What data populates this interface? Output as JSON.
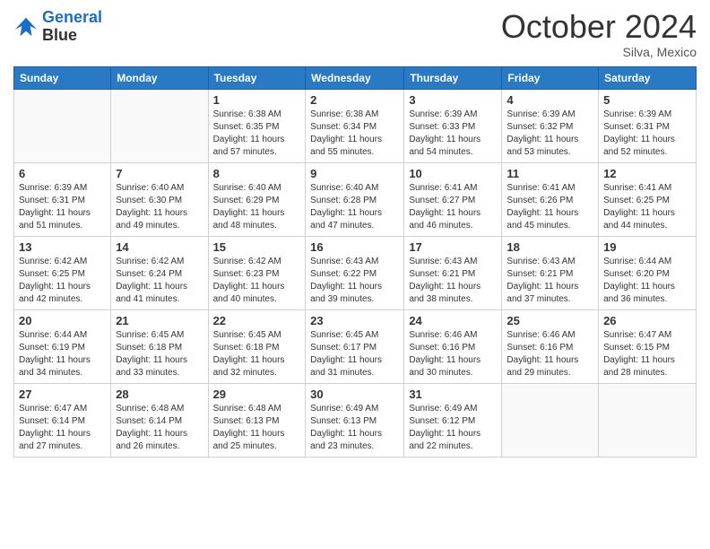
{
  "logo": {
    "line1": "General",
    "line2": "Blue"
  },
  "header": {
    "month": "October 2024",
    "location": "Silva, Mexico"
  },
  "weekdays": [
    "Sunday",
    "Monday",
    "Tuesday",
    "Wednesday",
    "Thursday",
    "Friday",
    "Saturday"
  ],
  "weeks": [
    [
      {
        "day": "",
        "info": ""
      },
      {
        "day": "",
        "info": ""
      },
      {
        "day": "1",
        "info": "Sunrise: 6:38 AM\nSunset: 6:35 PM\nDaylight: 11 hours and 57 minutes."
      },
      {
        "day": "2",
        "info": "Sunrise: 6:38 AM\nSunset: 6:34 PM\nDaylight: 11 hours and 55 minutes."
      },
      {
        "day": "3",
        "info": "Sunrise: 6:39 AM\nSunset: 6:33 PM\nDaylight: 11 hours and 54 minutes."
      },
      {
        "day": "4",
        "info": "Sunrise: 6:39 AM\nSunset: 6:32 PM\nDaylight: 11 hours and 53 minutes."
      },
      {
        "day": "5",
        "info": "Sunrise: 6:39 AM\nSunset: 6:31 PM\nDaylight: 11 hours and 52 minutes."
      }
    ],
    [
      {
        "day": "6",
        "info": "Sunrise: 6:39 AM\nSunset: 6:31 PM\nDaylight: 11 hours and 51 minutes."
      },
      {
        "day": "7",
        "info": "Sunrise: 6:40 AM\nSunset: 6:30 PM\nDaylight: 11 hours and 49 minutes."
      },
      {
        "day": "8",
        "info": "Sunrise: 6:40 AM\nSunset: 6:29 PM\nDaylight: 11 hours and 48 minutes."
      },
      {
        "day": "9",
        "info": "Sunrise: 6:40 AM\nSunset: 6:28 PM\nDaylight: 11 hours and 47 minutes."
      },
      {
        "day": "10",
        "info": "Sunrise: 6:41 AM\nSunset: 6:27 PM\nDaylight: 11 hours and 46 minutes."
      },
      {
        "day": "11",
        "info": "Sunrise: 6:41 AM\nSunset: 6:26 PM\nDaylight: 11 hours and 45 minutes."
      },
      {
        "day": "12",
        "info": "Sunrise: 6:41 AM\nSunset: 6:25 PM\nDaylight: 11 hours and 44 minutes."
      }
    ],
    [
      {
        "day": "13",
        "info": "Sunrise: 6:42 AM\nSunset: 6:25 PM\nDaylight: 11 hours and 42 minutes."
      },
      {
        "day": "14",
        "info": "Sunrise: 6:42 AM\nSunset: 6:24 PM\nDaylight: 11 hours and 41 minutes."
      },
      {
        "day": "15",
        "info": "Sunrise: 6:42 AM\nSunset: 6:23 PM\nDaylight: 11 hours and 40 minutes."
      },
      {
        "day": "16",
        "info": "Sunrise: 6:43 AM\nSunset: 6:22 PM\nDaylight: 11 hours and 39 minutes."
      },
      {
        "day": "17",
        "info": "Sunrise: 6:43 AM\nSunset: 6:21 PM\nDaylight: 11 hours and 38 minutes."
      },
      {
        "day": "18",
        "info": "Sunrise: 6:43 AM\nSunset: 6:21 PM\nDaylight: 11 hours and 37 minutes."
      },
      {
        "day": "19",
        "info": "Sunrise: 6:44 AM\nSunset: 6:20 PM\nDaylight: 11 hours and 36 minutes."
      }
    ],
    [
      {
        "day": "20",
        "info": "Sunrise: 6:44 AM\nSunset: 6:19 PM\nDaylight: 11 hours and 34 minutes."
      },
      {
        "day": "21",
        "info": "Sunrise: 6:45 AM\nSunset: 6:18 PM\nDaylight: 11 hours and 33 minutes."
      },
      {
        "day": "22",
        "info": "Sunrise: 6:45 AM\nSunset: 6:18 PM\nDaylight: 11 hours and 32 minutes."
      },
      {
        "day": "23",
        "info": "Sunrise: 6:45 AM\nSunset: 6:17 PM\nDaylight: 11 hours and 31 minutes."
      },
      {
        "day": "24",
        "info": "Sunrise: 6:46 AM\nSunset: 6:16 PM\nDaylight: 11 hours and 30 minutes."
      },
      {
        "day": "25",
        "info": "Sunrise: 6:46 AM\nSunset: 6:16 PM\nDaylight: 11 hours and 29 minutes."
      },
      {
        "day": "26",
        "info": "Sunrise: 6:47 AM\nSunset: 6:15 PM\nDaylight: 11 hours and 28 minutes."
      }
    ],
    [
      {
        "day": "27",
        "info": "Sunrise: 6:47 AM\nSunset: 6:14 PM\nDaylight: 11 hours and 27 minutes."
      },
      {
        "day": "28",
        "info": "Sunrise: 6:48 AM\nSunset: 6:14 PM\nDaylight: 11 hours and 26 minutes."
      },
      {
        "day": "29",
        "info": "Sunrise: 6:48 AM\nSunset: 6:13 PM\nDaylight: 11 hours and 25 minutes."
      },
      {
        "day": "30",
        "info": "Sunrise: 6:49 AM\nSunset: 6:13 PM\nDaylight: 11 hours and 23 minutes."
      },
      {
        "day": "31",
        "info": "Sunrise: 6:49 AM\nSunset: 6:12 PM\nDaylight: 11 hours and 22 minutes."
      },
      {
        "day": "",
        "info": ""
      },
      {
        "day": "",
        "info": ""
      }
    ]
  ]
}
